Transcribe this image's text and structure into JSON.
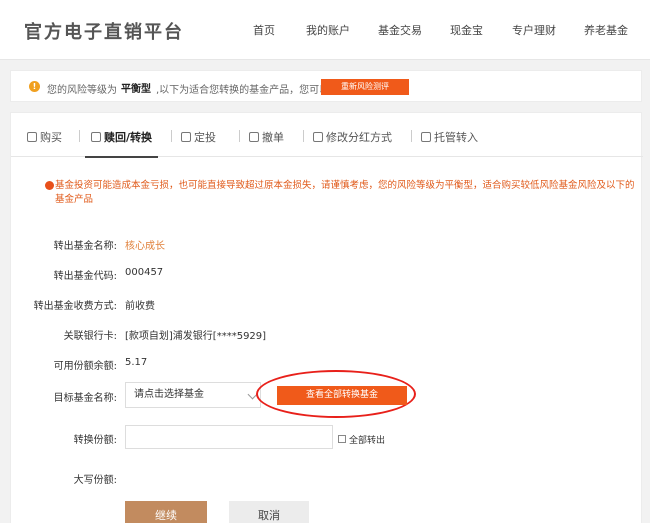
{
  "header": {
    "brand": "官方电子直销平台",
    "nav": [
      "首页",
      "我的账户",
      "基金交易",
      "现金宝",
      "专户理财",
      "养老基金"
    ]
  },
  "notice": {
    "prefix": "您的风险等级为",
    "level": "平衡型",
    "suffix": ",以下为适合您转换的基金产品，您可以",
    "button": "重新风险测评"
  },
  "tabs": [
    "购买",
    "赎回/转换",
    "定投",
    "撤单",
    "修改分红方式",
    "托管转入"
  ],
  "warning": "基金投资可能造成本金亏损，也可能直接导致超过原本金损失，请谨慎考虑，您的风险等级为平衡型，适合购买较低风险基金风险及以下的基金产品",
  "form": {
    "out_fund_name_label": "转出基金名称:",
    "out_fund_name": "核心成长",
    "out_fund_code_label": "转出基金代码:",
    "out_fund_code": "000457",
    "fee_mode_label": "转出基金收费方式:",
    "fee_mode": "前收费",
    "bank_card_label": "关联银行卡:",
    "bank_card": "[款项自划]浦发银行[****5929]",
    "available_label": "可用份额余额:",
    "available": "5.17",
    "target_label": "目标基金名称:",
    "target_placeholder": "请点击选择基金",
    "view_all_button": "查看全部转换基金",
    "convert_amount_label": "转换份额:",
    "convert_all_label": "全部转出",
    "upper_amount_label": "大写份额:",
    "continue_button": "继续",
    "cancel_button": "取消"
  },
  "colors": {
    "accent": "#f05a1a",
    "warning_text": "#e05a1a",
    "continue_bg": "#c28b5f",
    "highlight_circle": "#e8201a"
  }
}
